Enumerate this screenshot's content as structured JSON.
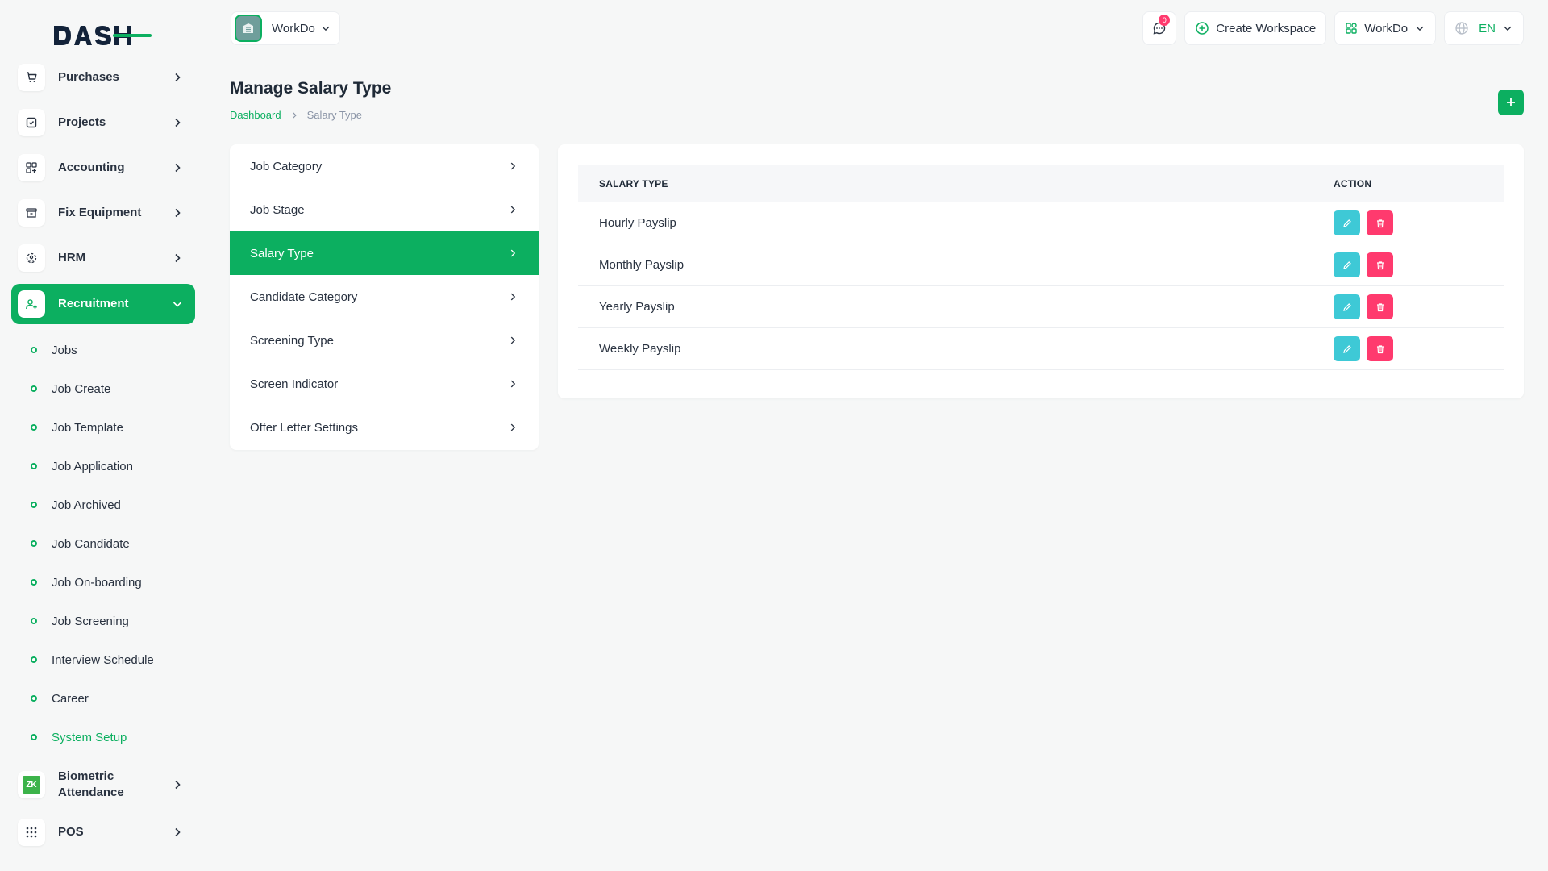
{
  "brand": {
    "logo_text": "DASH",
    "accent": "#0caf60"
  },
  "sidebar": {
    "items": [
      {
        "label": "Purchases",
        "icon": "cart-icon"
      },
      {
        "label": "Projects",
        "icon": "checkbox-icon"
      },
      {
        "label": "Accounting",
        "icon": "grid-plus-icon"
      },
      {
        "label": "Fix Equipment",
        "icon": "archive-icon"
      },
      {
        "label": "HRM",
        "icon": "hrm-icon"
      },
      {
        "label": "Recruitment",
        "icon": "user-plus-icon"
      }
    ],
    "recruitment_sub": [
      {
        "label": "Jobs"
      },
      {
        "label": "Job Create"
      },
      {
        "label": "Job Template"
      },
      {
        "label": "Job Application"
      },
      {
        "label": "Job Archived"
      },
      {
        "label": "Job Candidate"
      },
      {
        "label": "Job On-boarding"
      },
      {
        "label": "Job Screening"
      },
      {
        "label": "Interview Schedule"
      },
      {
        "label": "Career"
      },
      {
        "label": "System Setup"
      }
    ],
    "biometric": {
      "label": "Biometric Attendance",
      "badge": "ZK"
    },
    "pos": {
      "label": "POS"
    }
  },
  "topbar": {
    "workspace_name": "WorkDo",
    "messages_count": "0",
    "create_workspace": "Create Workspace",
    "company": "WorkDo",
    "language": "EN"
  },
  "page": {
    "title": "Manage Salary Type",
    "breadcrumb": {
      "home": "Dashboard",
      "current": "Salary Type"
    }
  },
  "settings_menu": [
    {
      "label": "Job Category"
    },
    {
      "label": "Job Stage"
    },
    {
      "label": "Salary Type"
    },
    {
      "label": "Candidate Category"
    },
    {
      "label": "Screening Type"
    },
    {
      "label": "Screen Indicator"
    },
    {
      "label": "Offer Letter Settings"
    }
  ],
  "table": {
    "headers": {
      "name": "SALARY TYPE",
      "action": "ACTION"
    },
    "rows": [
      {
        "name": "Hourly Payslip"
      },
      {
        "name": "Monthly Payslip"
      },
      {
        "name": "Yearly Payslip"
      },
      {
        "name": "Weekly Payslip"
      }
    ]
  },
  "colors": {
    "edit": "#3ec9d6",
    "delete": "#ff3a6e",
    "primary": "#0caf60"
  }
}
